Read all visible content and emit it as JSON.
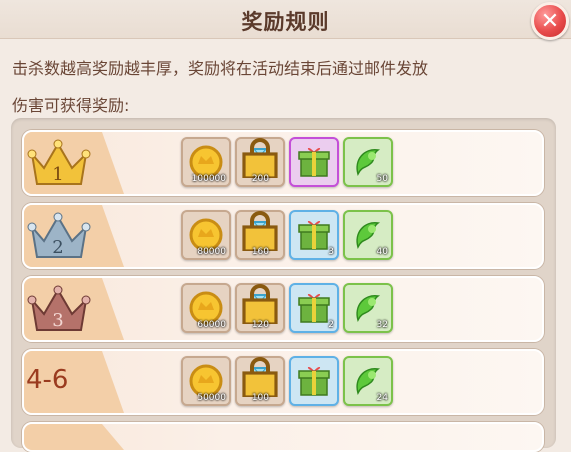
{
  "title": "奖励规则",
  "close_icon": "close-icon",
  "description": [
    "击杀数越高奖励越丰厚，奖励将在活动结束后通过邮件发放",
    "伤害可获得奖励:"
  ],
  "rows": [
    {
      "rank": "1",
      "rank_icon": "gold-crown-icon",
      "gift_border": "purple",
      "items": [
        {
          "name": "gold-coin-icon",
          "qty": "100000"
        },
        {
          "name": "diamond-icon",
          "qty": "200"
        },
        {
          "name": "gift-box-icon",
          "qty": ""
        },
        {
          "name": "green-feather-icon",
          "qty": "50"
        }
      ]
    },
    {
      "rank": "2",
      "rank_icon": "silver-crown-icon",
      "gift_border": "blue",
      "items": [
        {
          "name": "gold-coin-icon",
          "qty": "80000"
        },
        {
          "name": "diamond-icon",
          "qty": "160"
        },
        {
          "name": "gift-box-icon",
          "qty": "3"
        },
        {
          "name": "green-feather-icon",
          "qty": "40"
        }
      ]
    },
    {
      "rank": "3",
      "rank_icon": "bronze-crown-icon",
      "gift_border": "blue",
      "items": [
        {
          "name": "gold-coin-icon",
          "qty": "60000"
        },
        {
          "name": "diamond-icon",
          "qty": "120"
        },
        {
          "name": "gift-box-icon",
          "qty": "2"
        },
        {
          "name": "green-feather-icon",
          "qty": "32"
        }
      ]
    },
    {
      "rank": "4-6",
      "rank_icon": "",
      "gift_border": "blue",
      "items": [
        {
          "name": "gold-coin-icon",
          "qty": "50000"
        },
        {
          "name": "diamond-icon",
          "qty": "100"
        },
        {
          "name": "gift-box-icon",
          "qty": ""
        },
        {
          "name": "green-feather-icon",
          "qty": "24"
        }
      ]
    }
  ],
  "colors": {
    "gold": "#f2c23a",
    "silver": "#9db4c7",
    "bronze": "#b5726a",
    "accent": "#5b3a2b"
  }
}
